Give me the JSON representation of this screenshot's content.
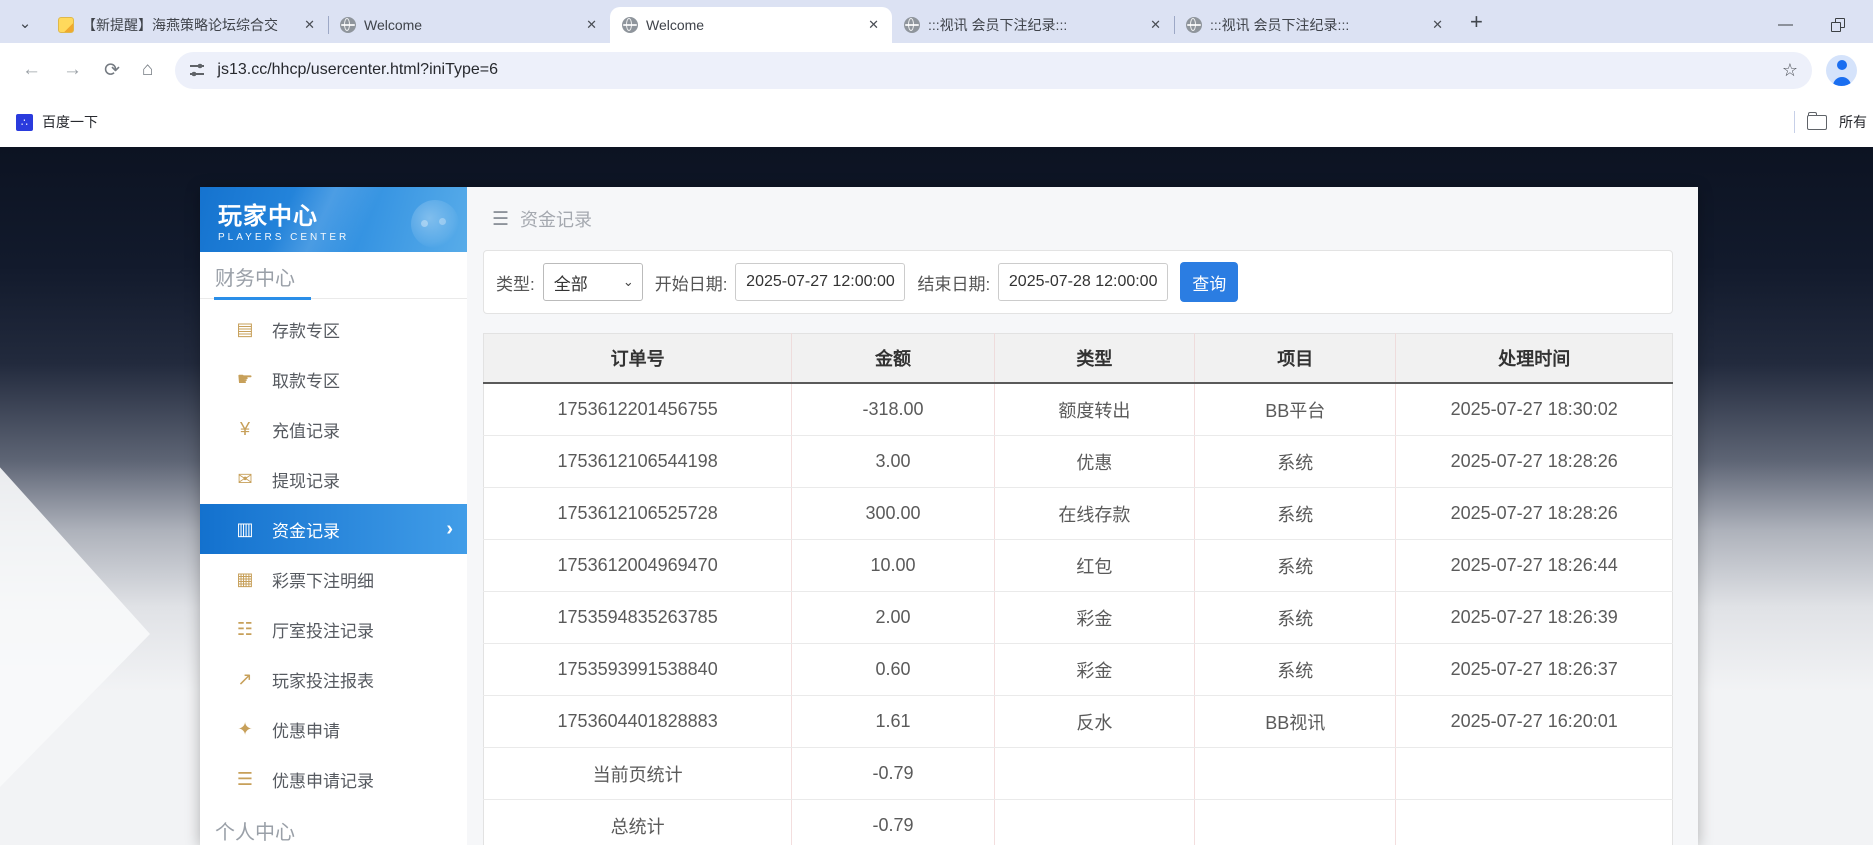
{
  "browser": {
    "tabs": [
      {
        "title": "【新提醒】海燕策略论坛综合交",
        "favicon": "note",
        "active": false
      },
      {
        "title": "Welcome",
        "favicon": "globe",
        "active": false
      },
      {
        "title": "Welcome",
        "favicon": "globe",
        "active": true
      },
      {
        "title": ":::视讯 会员下注纪录:::",
        "favicon": "globe",
        "active": false
      },
      {
        "title": ":::视讯 会员下注纪录:::",
        "favicon": "globe",
        "active": false
      }
    ],
    "url": "js13.cc/hhcp/usercenter.html?iniType=6",
    "bookmark_label": "百度一下",
    "bookmarks_right_label": "所有",
    "baidu_glyph": "∴"
  },
  "sidebar": {
    "banner_title": "玩家中心",
    "banner_subtitle": "PLAYERS CENTER",
    "section_title": "财务中心",
    "section_title2": "个人中心",
    "items": [
      {
        "label": "存款专区",
        "icon": "deposit-icon",
        "selected": false
      },
      {
        "label": "取款专区",
        "icon": "withdraw-icon",
        "selected": false
      },
      {
        "label": "充值记录",
        "icon": "recharge-icon",
        "selected": false
      },
      {
        "label": "提现记录",
        "icon": "cashout-icon",
        "selected": false
      },
      {
        "label": "资金记录",
        "icon": "funds-icon",
        "selected": true
      },
      {
        "label": "彩票下注明细",
        "icon": "lottery-icon",
        "selected": false
      },
      {
        "label": "厅室投注记录",
        "icon": "hall-icon",
        "selected": false
      },
      {
        "label": "玩家投注报表",
        "icon": "report-icon",
        "selected": false
      },
      {
        "label": "优惠申请",
        "icon": "promo-icon",
        "selected": false
      },
      {
        "label": "优惠申请记录",
        "icon": "promo-record-icon",
        "selected": false
      }
    ]
  },
  "icon_glyphs": {
    "deposit-icon": "▤",
    "withdraw-icon": "☛",
    "recharge-icon": "¥",
    "cashout-icon": "✉",
    "funds-icon": "▥",
    "lottery-icon": "▦",
    "hall-icon": "☷",
    "report-icon": "↗",
    "promo-icon": "✦",
    "promo-record-icon": "☰"
  },
  "main": {
    "header_title": "资金记录",
    "filter": {
      "type_label": "类型:",
      "type_value": "全部",
      "start_label": "开始日期:",
      "start_value": "2025-07-27 12:00:00",
      "end_label": "结束日期:",
      "end_value": "2025-07-28 12:00:00",
      "search_label": "查询"
    },
    "table": {
      "columns": [
        "订单号",
        "金额",
        "类型",
        "项目",
        "处理时间"
      ],
      "rows": [
        [
          "1753612201456755",
          "-318.00",
          "额度转出",
          "BB平台",
          "2025-07-27 18:30:02"
        ],
        [
          "1753612106544198",
          "3.00",
          "优惠",
          "系统",
          "2025-07-27 18:28:26"
        ],
        [
          "1753612106525728",
          "300.00",
          "在线存款",
          "系统",
          "2025-07-27 18:28:26"
        ],
        [
          "1753612004969470",
          "10.00",
          "红包",
          "系统",
          "2025-07-27 18:26:44"
        ],
        [
          "1753594835263785",
          "2.00",
          "彩金",
          "系统",
          "2025-07-27 18:26:39"
        ],
        [
          "1753593991538840",
          "0.60",
          "彩金",
          "系统",
          "2025-07-27 18:26:37"
        ],
        [
          "1753604401828883",
          "1.61",
          "反水",
          "BB视讯",
          "2025-07-27 16:20:01"
        ],
        [
          "当前页统计",
          "-0.79",
          "",
          "",
          ""
        ],
        [
          "总统计",
          "-0.79",
          "",
          "",
          ""
        ]
      ]
    }
  },
  "colors": {
    "accent_blue": "#2b7de2",
    "banner_blue": "#2b8ce0",
    "selected_menu_blue": "#1371ce",
    "menu_icon_gold": "#c7a05a",
    "tabbar_bg": "#dce2f3"
  }
}
